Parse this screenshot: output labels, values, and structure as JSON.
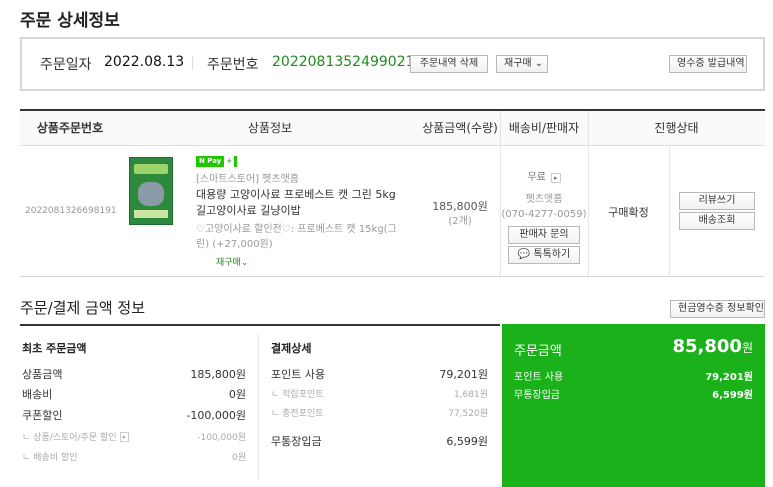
{
  "page_title": "주문 상세정보",
  "order_info": {
    "date_label": "주문일자",
    "date_value": "2022.08.13",
    "number_label": "주문번호",
    "number_value": "2022081352499021",
    "delete_button": "주문내역 삭제",
    "rebuy_button": "재구매",
    "receipt_button": "영수증 발급내역"
  },
  "table": {
    "headers": [
      "상품주문번호",
      "상품정보",
      "상품금액(수량)",
      "배송비/판매자",
      "진행상태"
    ],
    "row": {
      "product_order_no": "2022081326698191",
      "npay_badge": "N Pay",
      "store": "[스마트스토어] 펫츠앳홈",
      "product_name_1": "대용량 고양이사료 프로베스트 캣 그린 5kg",
      "product_name_2": "길고양이사료 길냥이밥",
      "option_1": "♡고양이사료 할인전♡: 프로베스트 캣 15kg(그",
      "option_2": "린) (+27,000원)",
      "rebuy_link": "재구매",
      "price": "185,800원",
      "quantity": "(2개)",
      "shipping": "무료",
      "seller": "펫츠앳홈",
      "phone": "(070-4277-0059)",
      "seller_inquiry_button": "판매자 문의",
      "talk_button": "톡톡하기",
      "status": "구매확정",
      "review_button": "리뷰쓰기",
      "tracking_button": "배송조회"
    }
  },
  "payment_section": {
    "title": "주문/결제 금액 정보",
    "cash_receipt_button": "현금영수증 정보확인",
    "initial": {
      "heading": "최초 주문금액",
      "product_amount_label": "상품금액",
      "product_amount_value": "185,800원",
      "shipping_label": "배송비",
      "shipping_value": "0원",
      "coupon_label": "쿠폰할인",
      "coupon_value": "-100,000원",
      "sub1_label": "ㄴ 상품/스토어/주문 할인",
      "sub1_value": "-100,000원",
      "sub2_label": "ㄴ 배송비 할인",
      "sub2_value": "0원"
    },
    "detail": {
      "heading": "결제상세",
      "point_label": "포인트 사용",
      "point_value": "79,201원",
      "sub1_label": "ㄴ 적립포인트",
      "sub1_value": "1,681원",
      "sub2_label": "ㄴ 충전포인트",
      "sub2_value": "77,520원",
      "bank_label": "무통장입금",
      "bank_value": "6,599원"
    },
    "total": {
      "label": "주문금액",
      "amount": "85,800",
      "unit": "원",
      "point_label": "포인트 사용",
      "point_value": "79,201원",
      "bank_label": "무통장입금",
      "bank_value": "6,599원"
    }
  },
  "colors": {
    "accent_green": "#1bb11b",
    "order_number_green": "#1f8c1f",
    "npay_green": "#1ec800"
  }
}
